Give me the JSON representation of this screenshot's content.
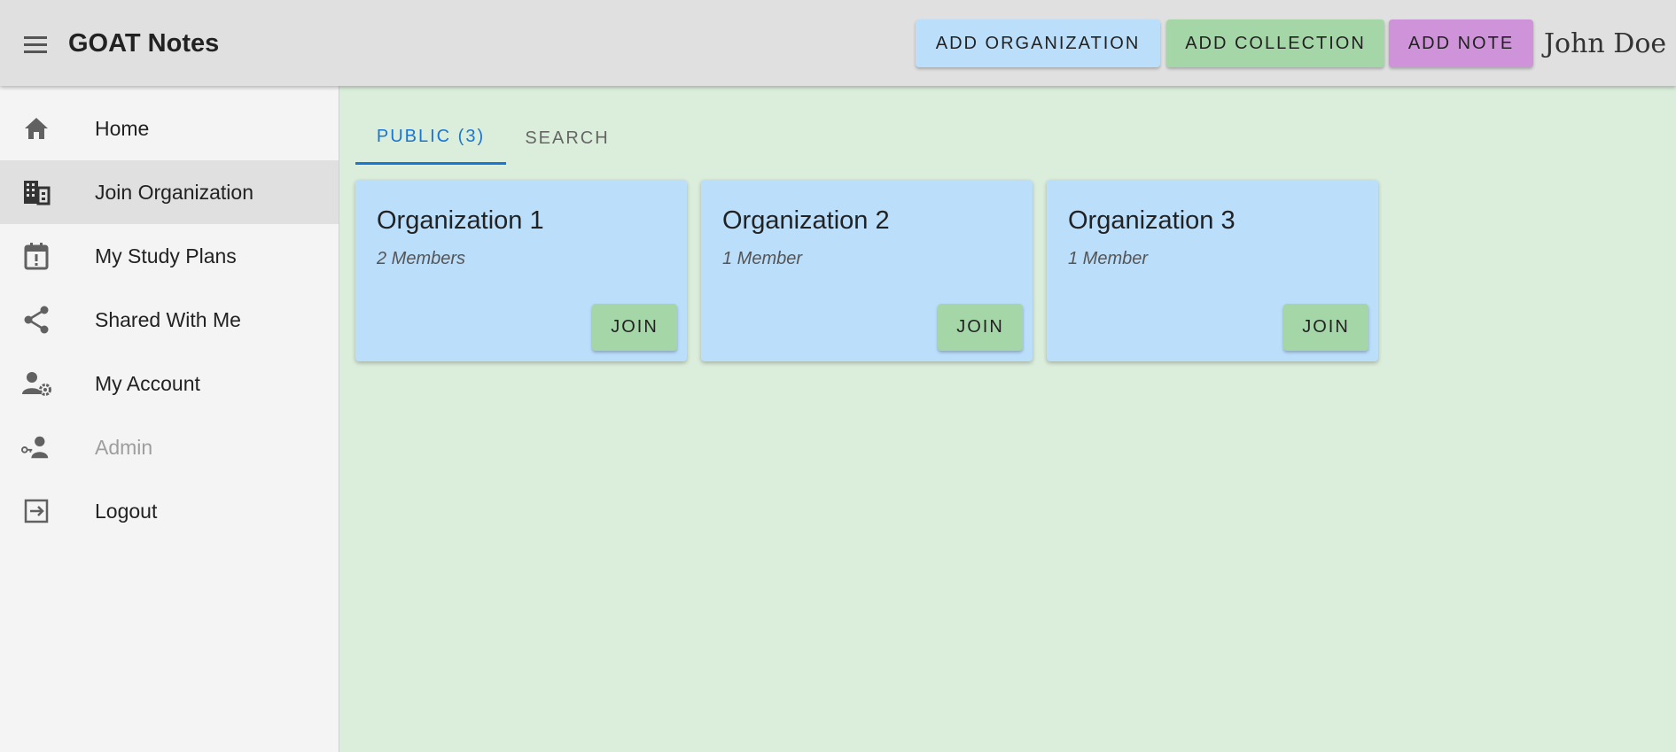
{
  "app": {
    "title": "GOAT Notes",
    "menu_icon": "menu-icon"
  },
  "toolbar": {
    "add_organization": "ADD ORGANIZATION",
    "add_collection": "ADD COLLECTION",
    "add_note": "ADD NOTE",
    "user_name": "John Doe"
  },
  "colors": {
    "appbar": "#e0e0e0",
    "add_organization": "#bbdefb",
    "add_collection": "#a5d6a7",
    "add_note": "#ce93d8",
    "content_bg": "#dbeddb",
    "active_tab": "#1976d2",
    "card_bg": "#bbdefb",
    "join_button": "#a5d6a7"
  },
  "sidebar": {
    "items": [
      {
        "label": "Home",
        "icon": "home-icon"
      },
      {
        "label": "Join Organization",
        "icon": "building-icon",
        "active": true
      },
      {
        "label": "My Study Plans",
        "icon": "calendar-alert-icon"
      },
      {
        "label": "Shared With Me",
        "icon": "share-icon"
      },
      {
        "label": "My Account",
        "icon": "account-settings-icon"
      },
      {
        "label": "Admin",
        "icon": "admin-key-icon",
        "disabled": true
      },
      {
        "label": "Logout",
        "icon": "logout-icon"
      }
    ]
  },
  "tabs": [
    {
      "label": "PUBLIC (3)",
      "selected": true
    },
    {
      "label": "SEARCH",
      "selected": false
    }
  ],
  "organizations": [
    {
      "name": "Organization 1",
      "members": "2 Members",
      "join_label": "JOIN"
    },
    {
      "name": "Organization 2",
      "members": "1 Member",
      "join_label": "JOIN"
    },
    {
      "name": "Organization 3",
      "members": "1 Member",
      "join_label": "JOIN"
    }
  ]
}
